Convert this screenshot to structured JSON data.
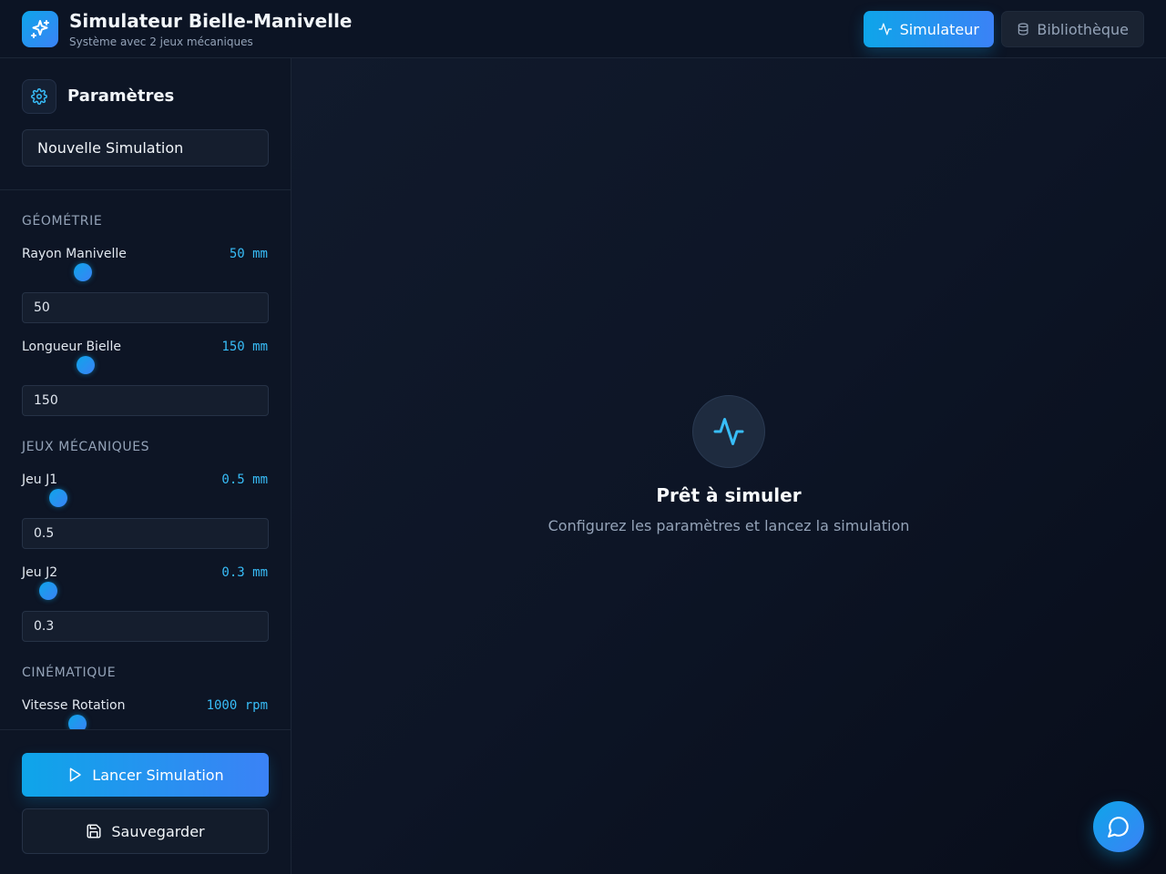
{
  "header": {
    "title": "Simulateur Bielle-Manivelle",
    "subtitle": "Système avec 2 jeux mécaniques",
    "nav": {
      "simulator": "Simulateur",
      "library": "Bibliothèque"
    }
  },
  "sidebar": {
    "title": "Paramètres",
    "simulation_name": "Nouvelle Simulation",
    "sections": {
      "geometry": "GÉOMÉTRIE",
      "clearances": "JEUX MÉCANIQUES",
      "kinematics": "CINÉMATIQUE"
    },
    "params": {
      "crank_radius": {
        "label": "Rayon Manivelle",
        "display": "50 mm",
        "value": "50",
        "slider_fraction": 0.21
      },
      "rod_length": {
        "label": "Longueur Bielle",
        "display": "150 mm",
        "value": "150",
        "slider_fraction": 0.22
      },
      "j1": {
        "label": "Jeu J1",
        "display": "0.5 mm",
        "value": "0.5",
        "slider_fraction": 0.11
      },
      "j2": {
        "label": "Jeu J2",
        "display": "0.3 mm",
        "value": "0.3",
        "slider_fraction": 0.07
      },
      "speed": {
        "label": "Vitesse Rotation",
        "display": "1000 rpm",
        "slider_fraction": 0.19
      }
    },
    "buttons": {
      "run": "Lancer Simulation",
      "save": "Sauvegarder"
    }
  },
  "main": {
    "empty_title": "Prêt à simuler",
    "empty_desc": "Configurez les paramètres et lancez la simulation"
  },
  "colors": {
    "accent": "#0ea5e9",
    "accent_2": "#3b82f6",
    "background": "#0b1120",
    "panel": "#0d1525"
  }
}
